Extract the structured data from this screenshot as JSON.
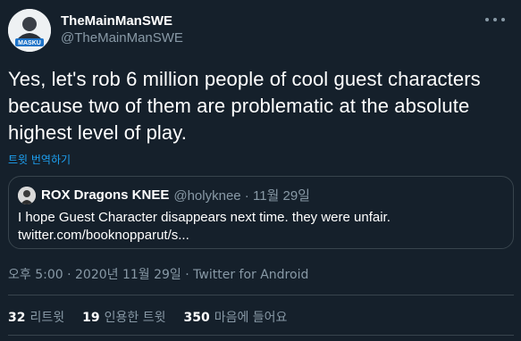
{
  "author": {
    "display_name": "TheMainManSWE",
    "handle": "@TheMainManSWE",
    "avatar_text": "MASKU"
  },
  "tweet": {
    "line1": "Yes, let's rob 6 million people of cool guest characters",
    "line2": "because two of them are problematic at the absolute",
    "line3": "highest level of play.",
    "translate_label": "트윗 번역하기"
  },
  "quoted": {
    "display_name": "ROX Dragons KNEE",
    "meta": "@holyknee · 11월 29일",
    "line1": "I hope Guest Character disappears next time. they were unfair.",
    "line2": "twitter.com/booknopparut/s..."
  },
  "meta": {
    "time_date_source": "오후 5:00 · 2020년 11월 29일 · Twitter for Android"
  },
  "stats": {
    "retweets_count": "32",
    "retweets_label": "리트윗",
    "quotes_count": "19",
    "quotes_label": "인용한 트윗",
    "likes_count": "350",
    "likes_label": "마음에 들어요"
  },
  "colors": {
    "background": "#15202b",
    "accent": "#1da1f2",
    "secondary_text": "#8899a6",
    "border": "#38444d"
  },
  "icons": {
    "more": "more-dots-icon"
  }
}
